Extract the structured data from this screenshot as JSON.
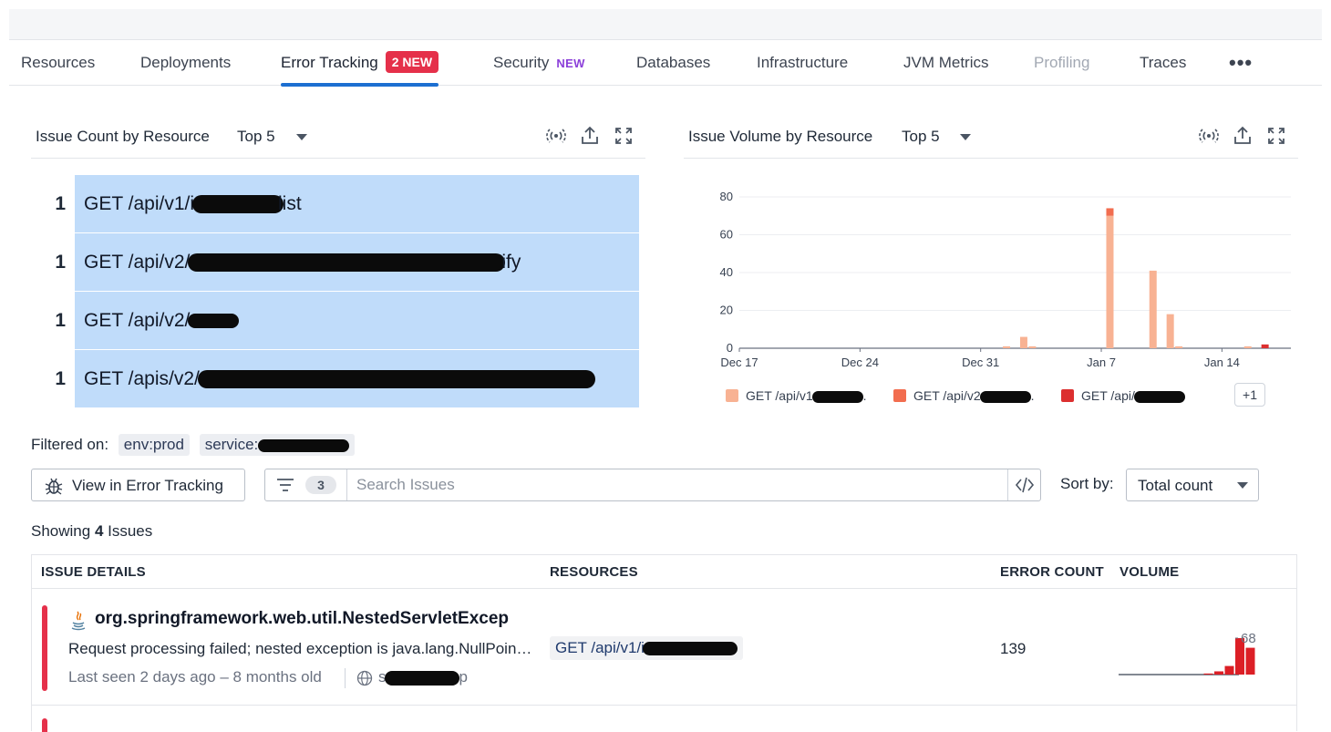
{
  "tabs": [
    {
      "label": "Resources"
    },
    {
      "label": "Deployments"
    },
    {
      "label": "Error Tracking",
      "badge": "2 NEW",
      "active": true
    },
    {
      "label": "Security",
      "tag": "NEW"
    },
    {
      "label": "Databases"
    },
    {
      "label": "Infrastructure"
    },
    {
      "label": "JVM Metrics"
    },
    {
      "label": "Profiling",
      "disabled": true
    },
    {
      "label": "Traces"
    },
    {
      "label": "•••"
    }
  ],
  "count_panel": {
    "title": "Issue Count by Resource",
    "selector": "Top 5",
    "rows": [
      {
        "count": "1",
        "label": "GET /api/v1/i",
        "label_tail": "list"
      },
      {
        "count": "1",
        "label": "GET /api/v2/",
        "label_tail": "ify"
      },
      {
        "count": "1",
        "label": "GET /api/v2/",
        "label_tail": ""
      },
      {
        "count": "1",
        "label": "GET /apis/v2/",
        "label_tail": ""
      }
    ]
  },
  "volume_panel": {
    "title": "Issue Volume by Resource",
    "selector": "Top 5",
    "legend": [
      {
        "label": "GET /api/v1",
        "tail": "",
        "color": "#f8b293"
      },
      {
        "label": "GET /api/v2",
        "tail": "",
        "color": "#f26d4f"
      },
      {
        "label": "GET /api/",
        "tail": "",
        "color": "#dc2f2f"
      }
    ],
    "more": "+1"
  },
  "chart_data": {
    "type": "bar",
    "x_ticks": [
      "Dec 17",
      "Dec 24",
      "Dec 31",
      "Jan 7",
      "Jan 14"
    ],
    "y_ticks": [
      "0",
      "20",
      "40",
      "60",
      "80"
    ],
    "ylim": [
      0,
      80
    ],
    "grid": true,
    "legend_position": "bottom",
    "series": [
      {
        "name": "GET /api/v1",
        "color": "#f8b293",
        "points": [
          [
            15.5,
            1
          ],
          [
            16.5,
            6
          ],
          [
            17,
            1
          ],
          [
            21.5,
            70
          ],
          [
            24,
            41
          ],
          [
            25,
            18
          ],
          [
            25.5,
            1
          ],
          [
            29.5,
            1
          ]
        ]
      },
      {
        "name": "GET /api/v2",
        "color": "#f26d4f",
        "points": [
          [
            21.5,
            4
          ]
        ]
      },
      {
        "name": "GET /api/",
        "color": "#dc2f2f",
        "points": [
          [
            30.5,
            2
          ]
        ]
      }
    ]
  },
  "filter": {
    "label": "Filtered on:",
    "chips": [
      "env:prod",
      "service:"
    ]
  },
  "toolbar": {
    "view_button": "View in Error Tracking",
    "filter_count": "3",
    "search_placeholder": "Search Issues",
    "sort_label": "Sort by:",
    "sort_value": "Total count"
  },
  "summary": {
    "prefix": "Showing ",
    "count": "4",
    "suffix": " Issues"
  },
  "table": {
    "headers": [
      "ISSUE DETAILS",
      "RESOURCES",
      "ERROR COUNT",
      "VOLUME"
    ],
    "rows": [
      {
        "title": "org.springframework.web.util.NestedServletExcep",
        "message": "Request processing failed; nested exception is java.lang.NullPointerException",
        "meta": "Last seen 2 days ago – 8 months old",
        "service": "s",
        "service_tail": "p",
        "resource": "GET /api/v1/i",
        "error_count": "139",
        "volume_max": "68",
        "volume_bars": [
          0,
          0,
          0,
          0,
          0,
          2,
          6,
          16,
          68,
          50,
          0,
          0
        ]
      }
    ]
  },
  "colors": {
    "accent": "#1c6fd1",
    "danger": "#e5304a",
    "bar_fill": "#c0dcfa"
  }
}
